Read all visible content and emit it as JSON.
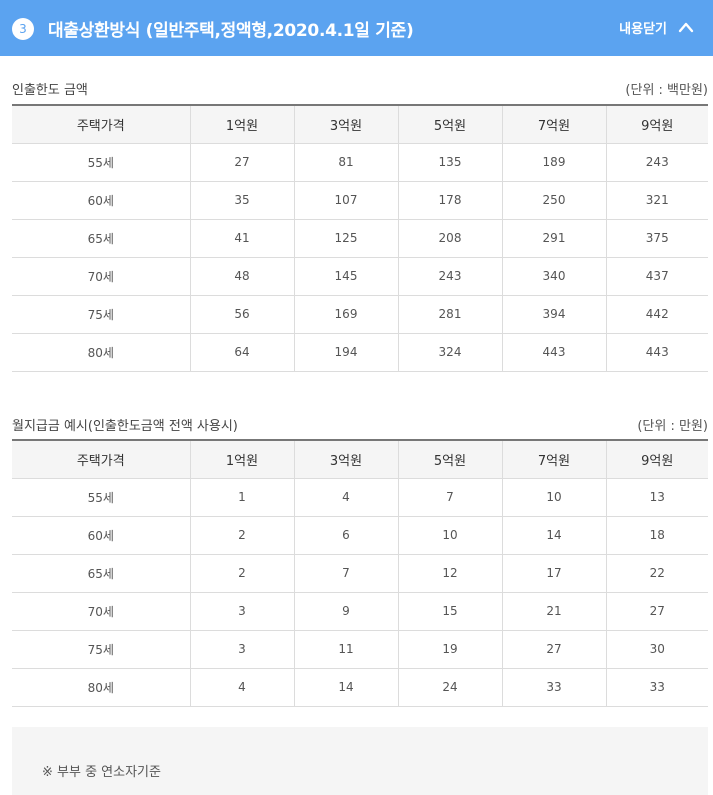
{
  "header": {
    "step": "3",
    "title": "대출상환방식 (일반주택,정액형,2020.4.1일 기준)",
    "toggle_label": "내용닫기",
    "toggle_icon": "chevron-up-icon"
  },
  "limit_table": {
    "title": "인출한도 금액",
    "unit": "(단위 : 백만원)",
    "columns": [
      "주택가격",
      "1억원",
      "3억원",
      "5억원",
      "7억원",
      "9억원"
    ],
    "rows": [
      [
        "55세",
        "27",
        "81",
        "135",
        "189",
        "243"
      ],
      [
        "60세",
        "35",
        "107",
        "178",
        "250",
        "321"
      ],
      [
        "65세",
        "41",
        "125",
        "208",
        "291",
        "375"
      ],
      [
        "70세",
        "48",
        "145",
        "243",
        "340",
        "437"
      ],
      [
        "75세",
        "56",
        "169",
        "281",
        "394",
        "442"
      ],
      [
        "80세",
        "64",
        "194",
        "324",
        "443",
        "443"
      ]
    ]
  },
  "monthly_table": {
    "title": "월지급금 예시(인출한도금액 전액 사용시)",
    "unit": "(단위 : 만원)",
    "columns": [
      "주택가격",
      "1억원",
      "3억원",
      "5억원",
      "7억원",
      "9억원"
    ],
    "rows": [
      [
        "55세",
        "1",
        "4",
        "7",
        "10",
        "13"
      ],
      [
        "60세",
        "2",
        "6",
        "10",
        "14",
        "18"
      ],
      [
        "65세",
        "2",
        "7",
        "12",
        "17",
        "22"
      ],
      [
        "70세",
        "3",
        "9",
        "15",
        "21",
        "27"
      ],
      [
        "75세",
        "3",
        "11",
        "19",
        "27",
        "30"
      ],
      [
        "80세",
        "4",
        "14",
        "24",
        "33",
        "33"
      ]
    ]
  },
  "note": {
    "text": "※ 부부 중 연소자기준"
  },
  "colors": {
    "header_bg": "#5ba3f0",
    "table_head_bg": "#f5f5f5",
    "note_bg": "#f5f5f5"
  }
}
